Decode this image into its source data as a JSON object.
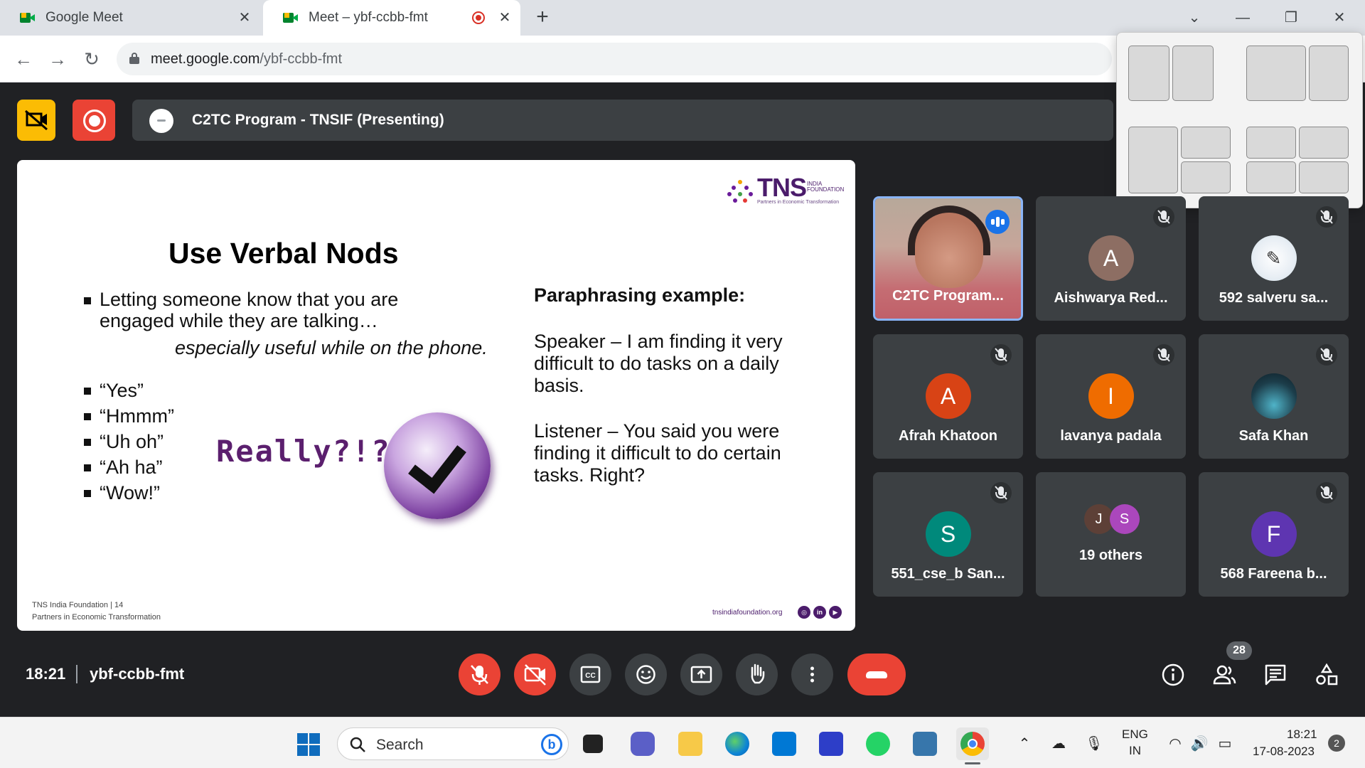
{
  "browser": {
    "tabs": [
      {
        "title": "Google Meet"
      },
      {
        "title": "Meet – ybf-ccbb-fmt"
      }
    ],
    "url_host": "meet.google.com",
    "url_path": "/ybf-ccbb-fmt"
  },
  "meet": {
    "presenting_title": "C2TC Program - TNSIF (Presenting)",
    "time": "18:21",
    "meeting_code": "ybf-ccbb-fmt",
    "people_count": "28",
    "accent_color": "#1a73e8",
    "end_call_color": "#ea4335",
    "controls": [
      {
        "name": "mic-off",
        "icon": "mic-off-icon"
      },
      {
        "name": "camera-off",
        "icon": "video-off-icon"
      },
      {
        "name": "captions",
        "icon": "captions-icon"
      },
      {
        "name": "reactions",
        "icon": "emoji-icon"
      },
      {
        "name": "present",
        "icon": "present-icon"
      },
      {
        "name": "raise-hand",
        "icon": "hand-icon"
      },
      {
        "name": "more-options",
        "icon": "more-vert-icon"
      }
    ]
  },
  "slide": {
    "logo": "TNS",
    "logo_sub": "INDIA FOUNDATION",
    "logo_tagline": "Partners in Economic Transformation",
    "title": "Use Verbal Nods",
    "bullet_main": "Letting someone know that you are engaged while they are talking…",
    "bullet_italic": "especially useful while on the phone.",
    "sub_bullets": [
      "“Yes”",
      "“Hmmm”",
      "“Uh oh”",
      "“Ah ha”",
      "“Wow!”"
    ],
    "really_text": "Really?!?!",
    "paraphrase_title": "Paraphrasing example:",
    "speaker_text": "Speaker – I am finding it very difficult to do tasks on a daily basis.",
    "listener_text": "Listener – You said you were finding it difficult to do certain tasks. Right?",
    "footer_line1": "TNS India Foundation | 14",
    "footer_line2": "Partners in Economic Transformation",
    "footer_url": "tnsindiafoundation.org"
  },
  "participants": [
    {
      "name": "C2TC Program...",
      "type": "video",
      "speaking": true
    },
    {
      "name": "Aishwarya Red...",
      "initial": "A",
      "color": "#8d6e63",
      "muted": true
    },
    {
      "name": "592 salveru sa...",
      "initial": "",
      "color": "#e8eef4",
      "muted": true
    },
    {
      "name": "Afrah Khatoon",
      "initial": "A",
      "color": "#d84315",
      "muted": true
    },
    {
      "name": "lavanya padala",
      "initial": "I",
      "color": "#ef6c00",
      "muted": true
    },
    {
      "name": "Safa Khan",
      "initial": "",
      "color": "#1c3d4a",
      "muted": true
    },
    {
      "name": "551_cse_b San...",
      "initial": "S",
      "color": "#00897b",
      "muted": true
    },
    {
      "name": "19 others",
      "initial": "",
      "color": "#3c4043",
      "muted": false
    },
    {
      "name": "568 Fareena b...",
      "initial": "F",
      "color": "#5e35b1",
      "muted": true
    }
  ],
  "others_avatars": [
    {
      "initial": "J",
      "color": "#5d4037"
    },
    {
      "initial": "S",
      "color": "#ab47bc"
    }
  ],
  "taskbar": {
    "search_label": "Search",
    "lang1": "ENG",
    "lang2": "IN",
    "time": "18:21",
    "date": "17-08-2023",
    "notifications": "2"
  }
}
